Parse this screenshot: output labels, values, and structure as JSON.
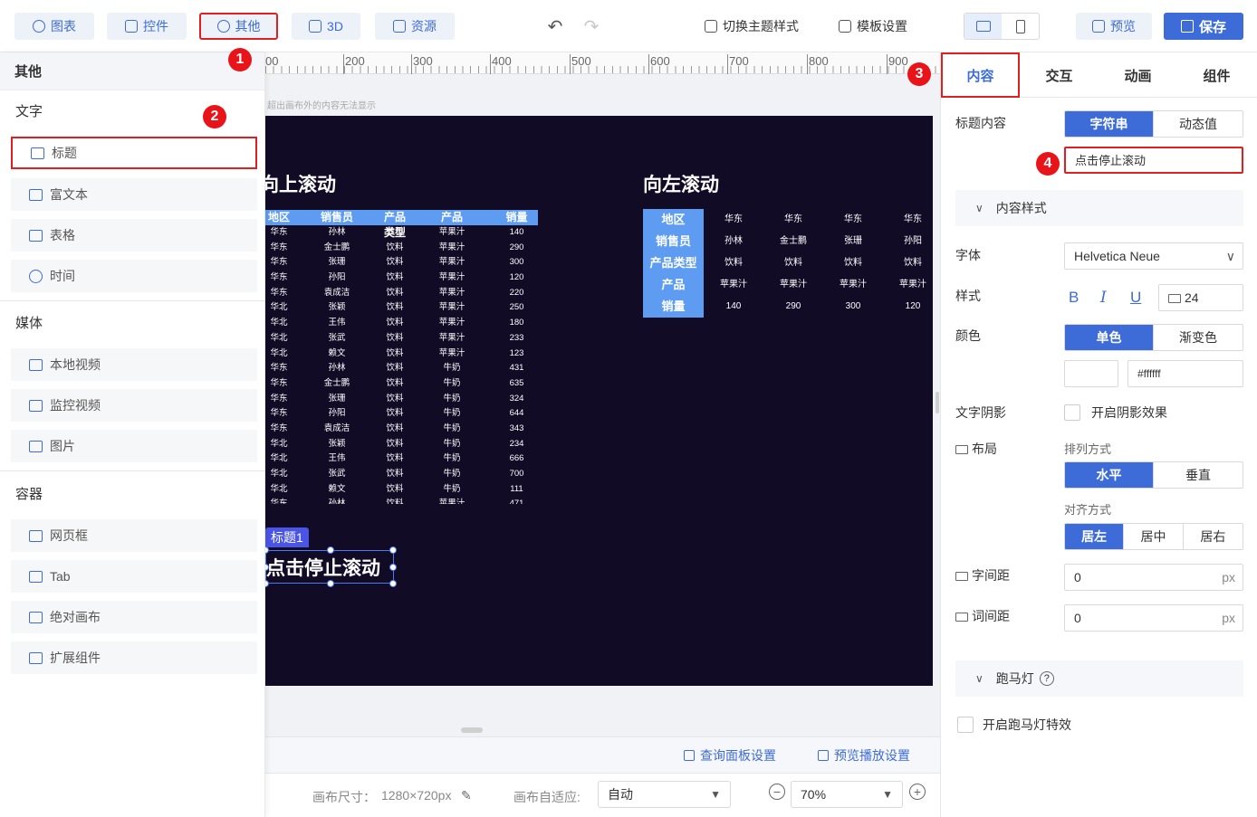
{
  "toolbar": {
    "chart": "图表",
    "control": "控件",
    "other": "其他",
    "three_d": "3D",
    "resource": "资源",
    "switch_theme": "切换主题样式",
    "template_settings": "模板设置",
    "preview": "预览",
    "save": "保存"
  },
  "badges": [
    "1",
    "2",
    "3",
    "4"
  ],
  "left_panel": {
    "title": "其他",
    "sections": [
      {
        "title": "文字",
        "items": [
          "标题",
          "富文本",
          "表格",
          "时间"
        ]
      },
      {
        "title": "媒体",
        "items": [
          "本地视频",
          "监控视频",
          "图片"
        ]
      },
      {
        "title": "容器",
        "items": [
          "网页框",
          "Tab",
          "绝对画布",
          "扩展组件"
        ]
      }
    ]
  },
  "ruler": {
    "ticks": [
      "00",
      "200",
      "300",
      "400",
      "500",
      "600",
      "700",
      "800",
      "900"
    ]
  },
  "canvas": {
    "hint": "超出画布外的内容无法显示",
    "left_title": "向上滚动",
    "right_title": "向左滚动",
    "v_table": {
      "headers": [
        "地区",
        "销售员",
        "产品类型",
        "产品",
        "销量"
      ],
      "rows": [
        [
          "华东",
          "孙林",
          "饮料",
          "苹果汁",
          "140"
        ],
        [
          "华东",
          "金士鹏",
          "饮料",
          "苹果汁",
          "290"
        ],
        [
          "华东",
          "张珊",
          "饮料",
          "苹果汁",
          "300"
        ],
        [
          "华东",
          "孙阳",
          "饮料",
          "苹果汁",
          "120"
        ],
        [
          "华东",
          "袁成洁",
          "饮料",
          "苹果汁",
          "220"
        ],
        [
          "华北",
          "张颖",
          "饮料",
          "苹果汁",
          "250"
        ],
        [
          "华北",
          "王伟",
          "饮料",
          "苹果汁",
          "180"
        ],
        [
          "华北",
          "张武",
          "饮料",
          "苹果汁",
          "233"
        ],
        [
          "华北",
          "赖文",
          "饮料",
          "苹果汁",
          "123"
        ],
        [
          "华东",
          "孙林",
          "饮料",
          "牛奶",
          "431"
        ],
        [
          "华东",
          "金士鹏",
          "饮料",
          "牛奶",
          "635"
        ],
        [
          "华东",
          "张珊",
          "饮料",
          "牛奶",
          "324"
        ],
        [
          "华东",
          "孙阳",
          "饮料",
          "牛奶",
          "644"
        ],
        [
          "华东",
          "袁成洁",
          "饮料",
          "牛奶",
          "343"
        ],
        [
          "华北",
          "张颖",
          "饮料",
          "牛奶",
          "234"
        ],
        [
          "华北",
          "王伟",
          "饮料",
          "牛奶",
          "666"
        ],
        [
          "华北",
          "张武",
          "饮料",
          "牛奶",
          "700"
        ],
        [
          "华北",
          "赖文",
          "饮料",
          "牛奶",
          "111"
        ],
        [
          "华东",
          "孙林",
          "饮料",
          "苹果汁",
          "471"
        ]
      ]
    },
    "h_table": {
      "rows": [
        {
          "header": "地区",
          "cells": [
            "华东",
            "华东",
            "华东",
            "华东"
          ]
        },
        {
          "header": "销售员",
          "cells": [
            "孙林",
            "金士鹏",
            "张珊",
            "孙阳"
          ]
        },
        {
          "header": "产品类型",
          "cells": [
            "饮料",
            "饮料",
            "饮料",
            "饮料"
          ]
        },
        {
          "header": "产品",
          "cells": [
            "苹果汁",
            "苹果汁",
            "苹果汁",
            "苹果汁"
          ]
        },
        {
          "header": "销量",
          "cells": [
            "140",
            "290",
            "300",
            "120"
          ]
        }
      ]
    },
    "selected": {
      "tag": "标题1",
      "text": "点击停止滚动"
    }
  },
  "bottom": {
    "query_panel": "查询面板设置",
    "preview_play": "预览播放设置",
    "size_label": "画布尺寸：",
    "size_value": "1280×720px",
    "adapt_label": "画布自适应:",
    "adapt_value": "自动",
    "zoom_value": "70%"
  },
  "right_panel": {
    "tabs": [
      "内容",
      "交互",
      "动画",
      "组件"
    ],
    "title_content_label": "标题内容",
    "title_type_options": [
      "字符串",
      "动态值"
    ],
    "title_value": "点击停止滚动",
    "content_style": "内容样式",
    "font_label": "字体",
    "font_value": "Helvetica Neue",
    "style_label": "样式",
    "font_size": "24",
    "color_label": "颜色",
    "color_options": [
      "单色",
      "渐变色"
    ],
    "color_value": "#ffffff",
    "shadow_label": "文字阴影",
    "shadow_option": "开启阴影效果",
    "layout_label": "布局",
    "arrange_label": "排列方式",
    "arrange_options": [
      "水平",
      "垂直"
    ],
    "align_label": "对齐方式",
    "align_options": [
      "居左",
      "居中",
      "居右"
    ],
    "letter_spacing_label": "字间距",
    "letter_spacing_value": "0",
    "word_spacing_label": "词间距",
    "word_spacing_value": "0",
    "unit": "px",
    "marquee_label": "跑马灯",
    "marquee_option": "开启跑马灯特效"
  },
  "colors": {
    "accent": "#3d6cd9",
    "canvas_bg": "#120b26",
    "table_header": "#5d9cf0",
    "highlight": "#e02020"
  }
}
